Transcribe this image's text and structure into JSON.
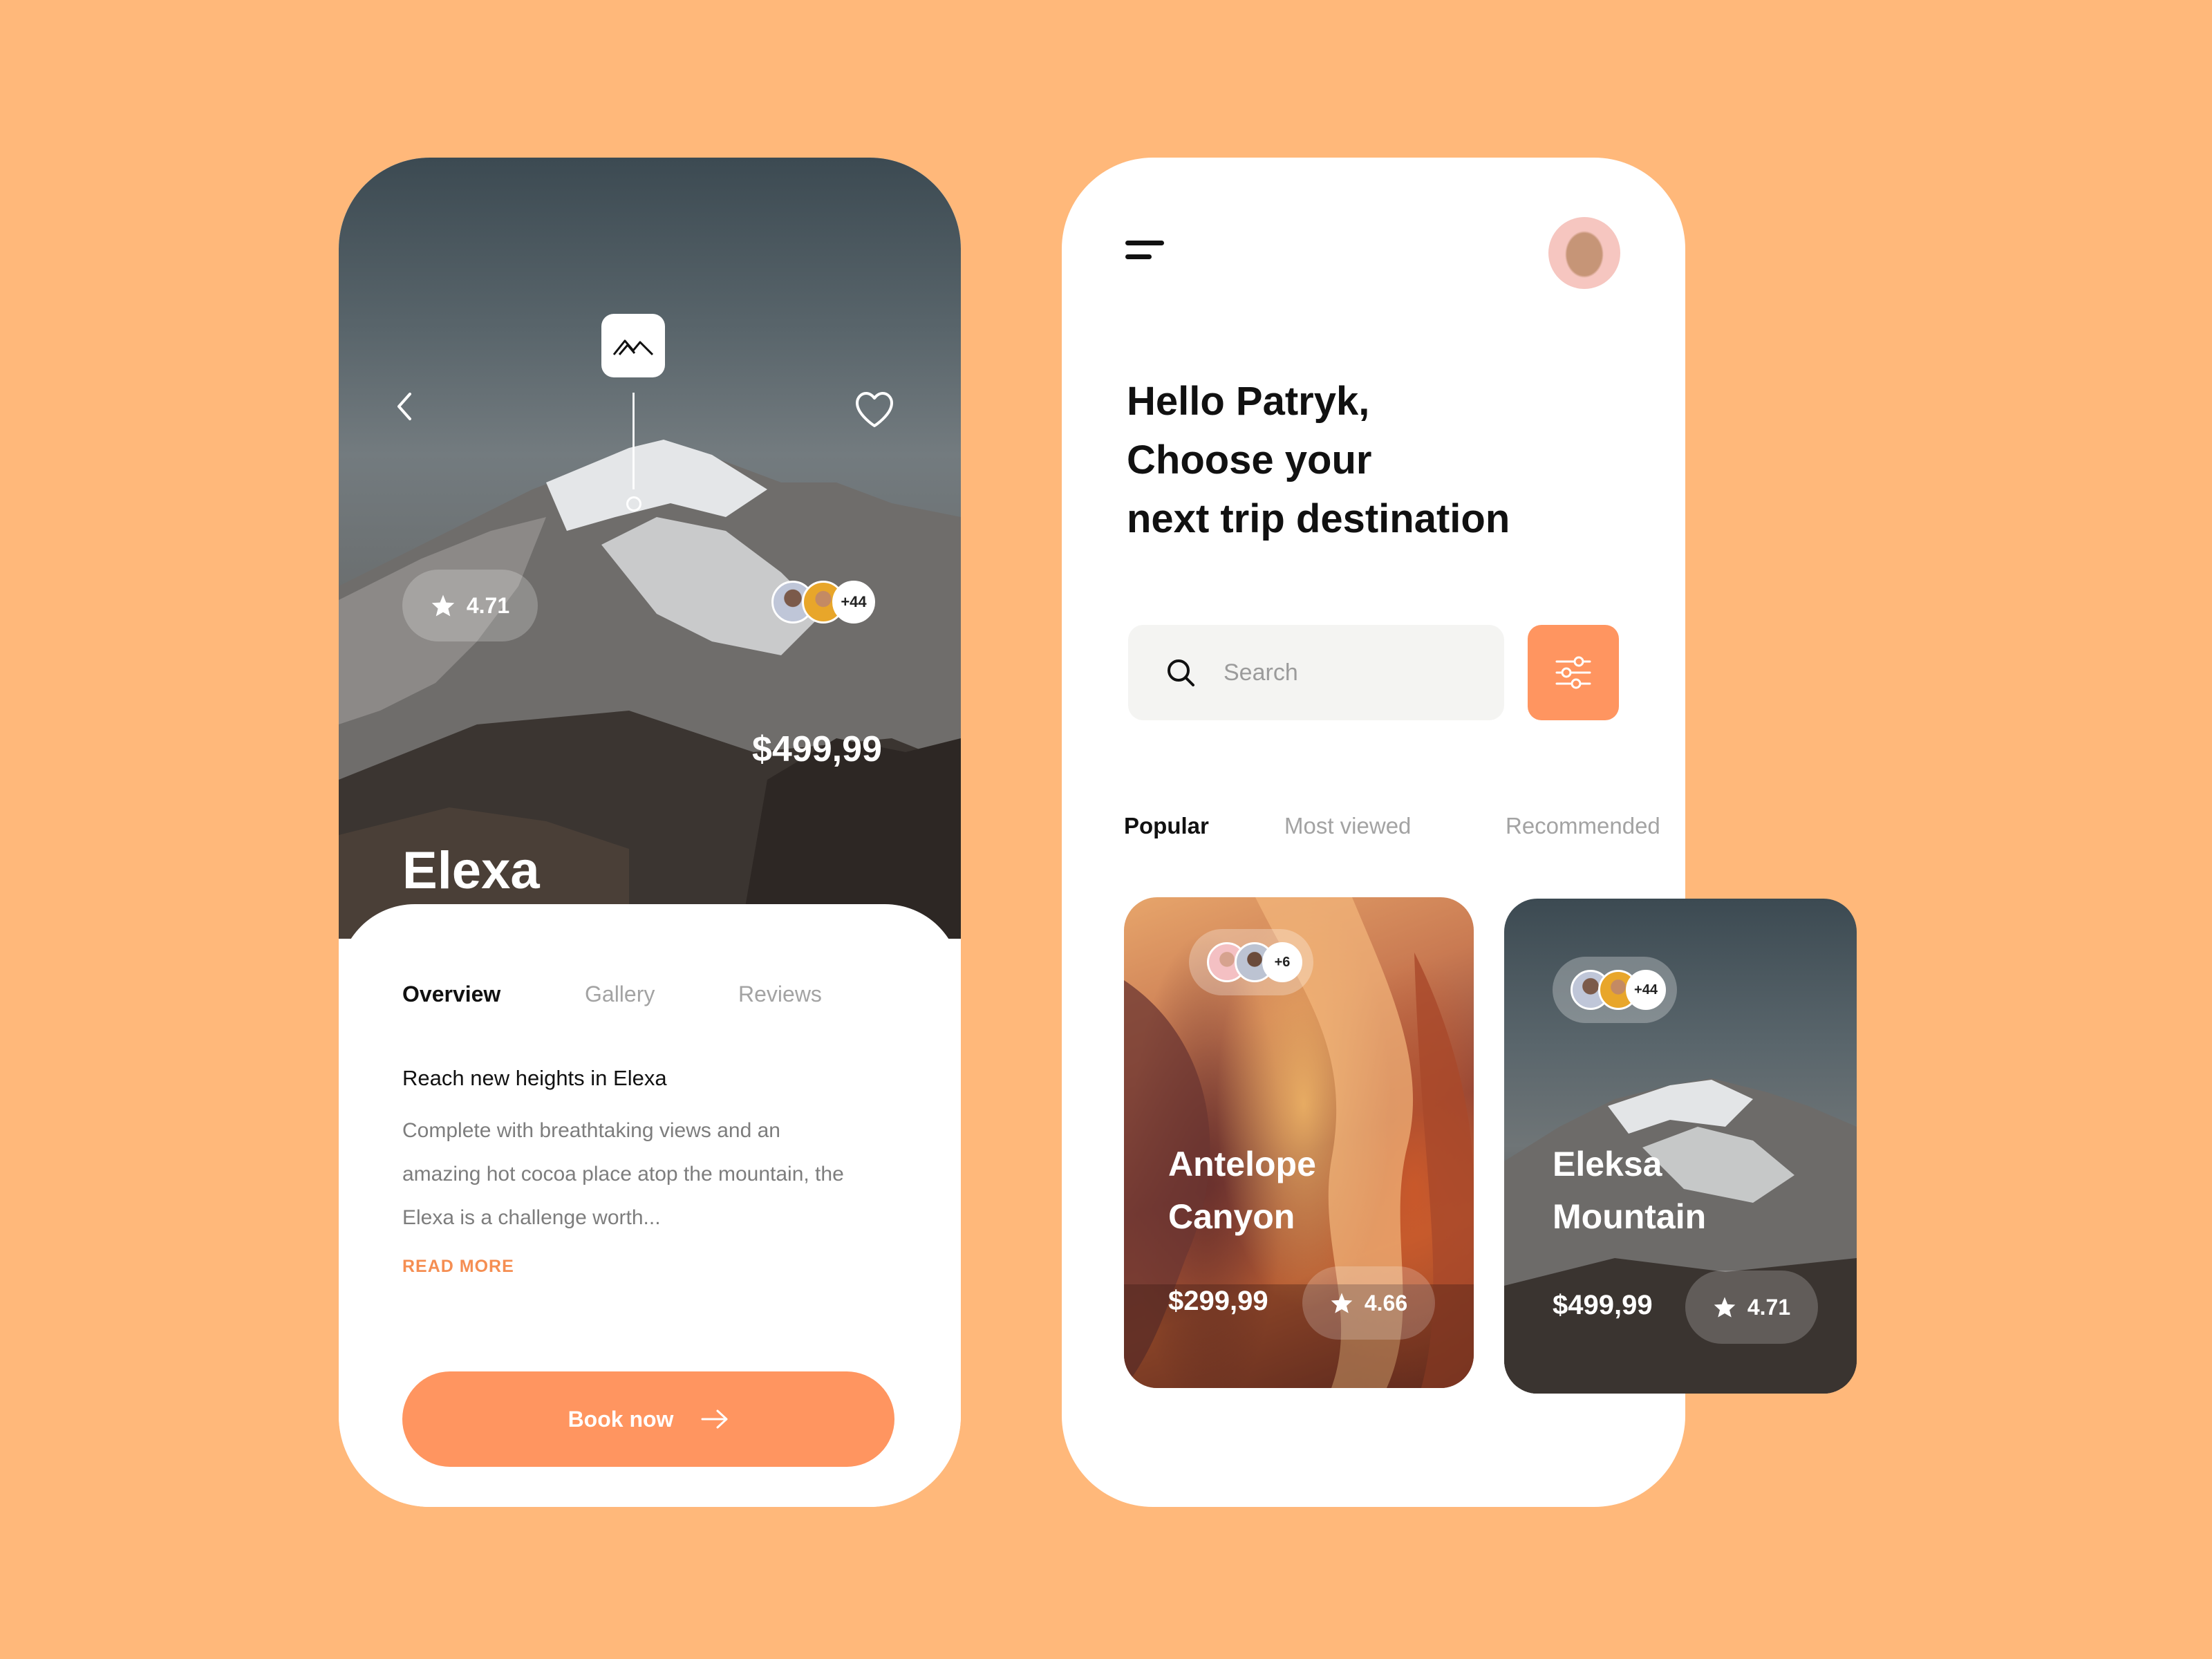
{
  "detail": {
    "rating": "4.71",
    "attendees_more": "+44",
    "title": "Elexa\nMountain",
    "price": "$499,99",
    "tabs": [
      "Overview",
      "Gallery",
      "Reviews"
    ],
    "description_title": "Reach new heights in Elexa",
    "description_body": "Complete with breathtaking views and an amazing hot cocoa place atop the mountain, the Elexa is a challenge worth...",
    "read_more": "READ MORE",
    "book_label": "Book now"
  },
  "home": {
    "greeting": "Hello Patryk,\nChoose your\nnext trip destination",
    "search_placeholder": "Search",
    "tabs": [
      "Popular",
      "Most viewed",
      "Recommended"
    ],
    "cards": [
      {
        "title": "Antelope\nCanyon",
        "price": "$299,99",
        "rating": "4.66",
        "attendees_more": "+6"
      },
      {
        "title": "Eleksa\nMountain",
        "price": "$499,99",
        "rating": "4.71",
        "attendees_more": "+44"
      }
    ]
  },
  "colors": {
    "background": "#FFB87A",
    "accent": "#FF9560",
    "accent_text": "#F58E52"
  },
  "icons": [
    "chevron-left-icon",
    "heart-icon",
    "mountain-logo-icon",
    "star-icon",
    "arrow-right-icon",
    "menu-icon",
    "search-icon",
    "filter-sliders-icon"
  ]
}
